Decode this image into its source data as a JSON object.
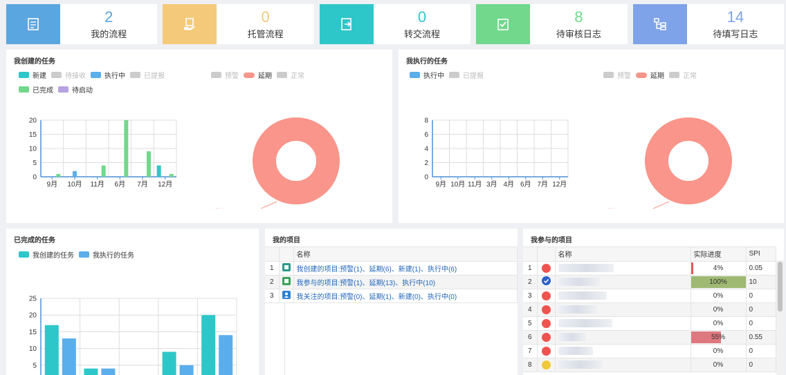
{
  "stats": [
    {
      "value": "2",
      "label": "我的流程",
      "color": "#5aa6e0",
      "icon": "flow-icon"
    },
    {
      "value": "0",
      "label": "托管流程",
      "color": "#f5c97a",
      "icon": "hand-doc-icon"
    },
    {
      "value": "0",
      "label": "转交流程",
      "color": "#2ec7c9",
      "icon": "transfer-icon"
    },
    {
      "value": "8",
      "label": "待审核日志",
      "color": "#72d88c",
      "icon": "review-icon"
    },
    {
      "value": "14",
      "label": "待填写日志",
      "color": "#7fa3e8",
      "icon": "tree-icon"
    }
  ],
  "created_tasks": {
    "title": "我创建的任务",
    "legend_bar": [
      {
        "label": "新建",
        "color": "#2ec7c9",
        "on": true
      },
      {
        "label": "待接收",
        "color": "#cccccc",
        "on": false
      },
      {
        "label": "执行中",
        "color": "#5aaeeb",
        "on": true
      },
      {
        "label": "已提报",
        "color": "#cccccc",
        "on": false
      },
      {
        "label": "已完成",
        "color": "#72d88c",
        "on": true
      },
      {
        "label": "待启动",
        "color": "#b6a2de",
        "on": true
      }
    ],
    "legend_pie": [
      {
        "label": "预警",
        "color": "#cccccc",
        "on": false
      },
      {
        "label": "延期",
        "color": "#f9958a",
        "on": true
      },
      {
        "label": "正常",
        "color": "#cccccc",
        "on": false
      }
    ],
    "pie_label": "延期(100.00%)"
  },
  "executed_tasks": {
    "title": "我执行的任务",
    "legend_bar": [
      {
        "label": "执行中",
        "color": "#5aaeeb",
        "on": true
      },
      {
        "label": "已提报",
        "color": "#cccccc",
        "on": false
      }
    ],
    "legend_pie": [
      {
        "label": "预警",
        "color": "#cccccc",
        "on": false
      },
      {
        "label": "延期",
        "color": "#f9958a",
        "on": true
      },
      {
        "label": "正常",
        "color": "#cccccc",
        "on": false
      }
    ],
    "pie_label": "延期(100.00%)"
  },
  "completed_tasks": {
    "title": "已完成的任务",
    "legend": [
      {
        "label": "我创建的任务",
        "color": "#2ec7c9"
      },
      {
        "label": "我执行的任务",
        "color": "#5aaeeb"
      }
    ]
  },
  "my_projects": {
    "title": "我的项目",
    "header": "名称",
    "rows": [
      {
        "num": "1",
        "name": "我创建的项目:预警(1)、延期(6)、新建(1)、执行中(6)",
        "icon_color": "#2b9a8a"
      },
      {
        "num": "2",
        "name": "我参与的项目:预警(1)、延期(13)、执行中(10)",
        "icon_color": "#3aa35a"
      },
      {
        "num": "3",
        "name": "我关注的项目:预警(0)、延期(1)、新建(0)、执行中(0)",
        "icon_color": "#2d7fd0"
      }
    ]
  },
  "joined_projects": {
    "title": "我参与的项目",
    "headers": [
      "名称",
      "实际进度",
      "SPI"
    ],
    "rows": [
      {
        "num": "1",
        "status": "red",
        "progress": "4%",
        "fraction": 0.04,
        "bar_color": "#e05a5a",
        "spi": "0.05"
      },
      {
        "num": "2",
        "status": "check",
        "progress": "100%",
        "fraction": 1.0,
        "bar_color": "#8fae5a",
        "spi": "10"
      },
      {
        "num": "3",
        "status": "red",
        "progress": "0%",
        "fraction": 0,
        "bar_color": "#e05a5a",
        "spi": "0"
      },
      {
        "num": "4",
        "status": "red",
        "progress": "0%",
        "fraction": 0,
        "bar_color": "#e05a5a",
        "spi": "0"
      },
      {
        "num": "5",
        "status": "red",
        "progress": "0%",
        "fraction": 0,
        "bar_color": "#e05a5a",
        "spi": "0"
      },
      {
        "num": "6",
        "status": "red",
        "progress": "55%",
        "fraction": 0.55,
        "bar_color": "#d9626a",
        "spi": "0.55"
      },
      {
        "num": "7",
        "status": "red",
        "progress": "0%",
        "fraction": 0,
        "bar_color": "#e05a5a",
        "spi": "0"
      },
      {
        "num": "8",
        "status": "yellow",
        "progress": "0%",
        "fraction": 0,
        "bar_color": "#e05a5a",
        "spi": "0"
      }
    ]
  },
  "chart_data": [
    {
      "type": "bar",
      "categories": [
        "9月",
        "10月",
        "11月",
        "6月",
        "7月",
        "12月"
      ],
      "series": [
        {
          "name": "新建",
          "values": [
            0,
            0,
            0,
            0,
            0,
            4
          ],
          "color": "#2ec7c9"
        },
        {
          "name": "执行中",
          "values": [
            0,
            2,
            0,
            0,
            0,
            0
          ],
          "color": "#5aaeeb"
        },
        {
          "name": "已完成",
          "values": [
            1,
            0,
            4,
            20,
            9,
            1
          ],
          "color": "#72d88c"
        }
      ],
      "yticks": [
        0,
        5,
        10,
        15,
        20
      ],
      "ylim": [
        0,
        20
      ],
      "grid": true
    },
    {
      "type": "pie",
      "slices": [
        {
          "name": "延期",
          "value": 100,
          "color": "#f9958a"
        }
      ]
    },
    {
      "type": "bar",
      "categories": [
        "9月",
        "10月",
        "11月",
        "3月",
        "4月",
        "6月",
        "7月",
        "12月"
      ],
      "series": [
        {
          "name": "执行中",
          "values": [
            0,
            0,
            0,
            0,
            0,
            0,
            0,
            0
          ],
          "color": "#5aaeeb"
        }
      ],
      "yticks": [
        0,
        2,
        4,
        6,
        8
      ],
      "ylim": [
        0,
        8
      ],
      "grid": true
    },
    {
      "type": "pie",
      "slices": [
        {
          "name": "延期",
          "value": 100,
          "color": "#f9958a"
        }
      ]
    },
    {
      "type": "bar",
      "categories": [
        "",
        "",
        "",
        "",
        ""
      ],
      "series": [
        {
          "name": "我创建的任务",
          "values": [
            17,
            4,
            1,
            9,
            20
          ],
          "color": "#2ec7c9"
        },
        {
          "name": "我执行的任务",
          "values": [
            13,
            4,
            1,
            5,
            14
          ],
          "color": "#5aaeeb"
        }
      ],
      "yticks": [
        0,
        5,
        10,
        15,
        20,
        25
      ],
      "ylim": [
        0,
        25
      ],
      "grid": true
    }
  ]
}
